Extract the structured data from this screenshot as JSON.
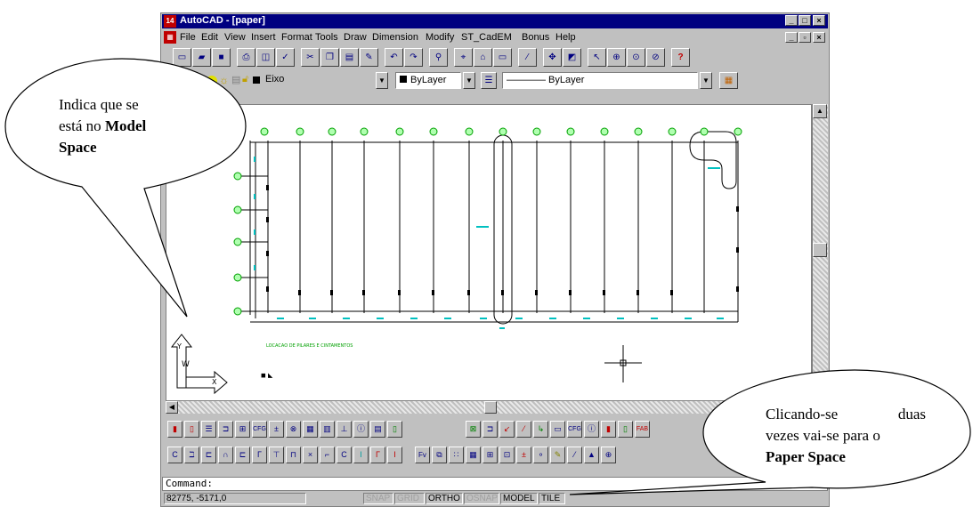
{
  "window": {
    "title": "AutoCAD - [paper]",
    "app_icon_text": "14",
    "min_label": "_",
    "max_label": "□",
    "close_label": "×",
    "child_min_label": "_",
    "child_restore_label": "▫",
    "child_close_label": "×"
  },
  "menu": {
    "items": [
      "File",
      "Edit",
      "View",
      "Insert",
      "Format",
      "Tools",
      "Draw",
      "Dimension",
      "Modify",
      "ST_CadEM",
      "Bonus",
      "Help"
    ]
  },
  "object_properties": {
    "layer_value": "Eixo",
    "color_value": "ByLayer",
    "linetype_value": "———— ByLayer"
  },
  "drawing": {
    "drawing_label": "LOCACAO DE PILARES E CINTAMENTOS"
  },
  "command": {
    "prompt": "Command:"
  },
  "status": {
    "coordinates": "82775, -5171,0",
    "snap": "SNAP",
    "grid": "GRID",
    "ortho": "ORTHO",
    "osnap": "OSNAP",
    "model": "MODEL",
    "tile": "TILE"
  },
  "callouts": {
    "left": {
      "line1": "Indica que se",
      "line2": "está no",
      "bold2": "Model",
      "line3": "Space"
    },
    "right": {
      "line1": "Clicando-se duas",
      "line2": "vezes vai-se para o",
      "line3": "Paper Space"
    }
  },
  "colors": {
    "title_bar": "#000080",
    "grid_cyan": "#00c0c0",
    "column_green": "#00a000",
    "drawing_label_green": "#00a000"
  }
}
